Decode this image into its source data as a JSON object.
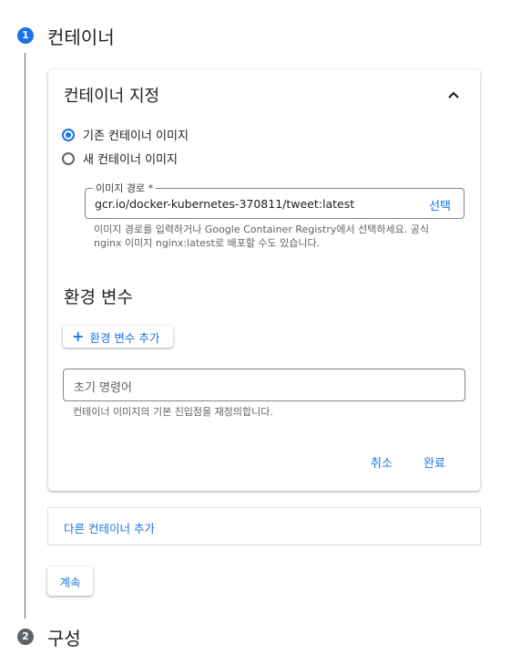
{
  "steps": [
    {
      "number": "1",
      "title": "컨테이너"
    },
    {
      "number": "2",
      "title": "구성"
    }
  ],
  "container_card": {
    "title": "컨테이너 지정",
    "collapse_icon": "chevron-up-icon",
    "radio_options": [
      {
        "label": "기존 컨테이너 이미지",
        "checked": true
      },
      {
        "label": "새 컨테이너 이미지",
        "checked": false
      }
    ],
    "image_path": {
      "label": "이미지 경로 *",
      "value": "gcr.io/docker-kubernetes-370811/tweet:latest",
      "action": "선택",
      "hint": "이미지 경로를 입력하거나 Google Container Registry에서 선택하세요. 공식 nginx 이미지 nginx:latest로 배포할 수도 있습니다."
    },
    "env_section": {
      "title": "환경 변수",
      "add_button": "환경 변수 추가"
    },
    "init_command": {
      "placeholder": "초기 명령어",
      "hint": "컨테이너 이미지의 기본 진입점을 재정의합니다."
    },
    "cancel": "취소",
    "done": "완료"
  },
  "add_container": "다른 컨테이너 추가",
  "continue": "계속",
  "colors": {
    "accent": "#1a73e8",
    "step_inactive": "#5f6368"
  }
}
